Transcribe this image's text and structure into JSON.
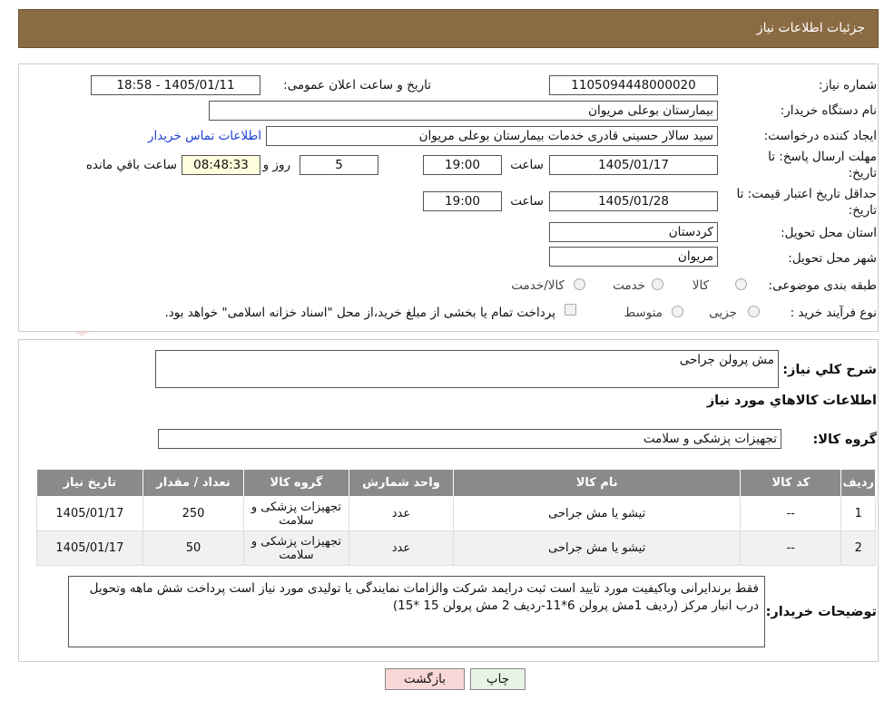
{
  "header": {
    "title": "جزئیات اطلاعات نیاز"
  },
  "form": {
    "need_number_label": "شماره نیاز:",
    "need_number": "1105094448000020",
    "announce_label": "تاریخ و ساعت اعلان عمومی:",
    "announce_value": "1405/01/11 - 18:58",
    "buyer_org_label": "نام دستگاه خریدار:",
    "buyer_org": "بیمارستان بوعلی مریوان",
    "creator_label": "ایجاد کننده درخواست:",
    "creator": "سید سالار حسینی قادری خدمات بیمارستان بوعلی مریوان",
    "contact_link": "اطلاعات تماس خریدار",
    "deadline_label_1": "مهلت ارسال پاسخ: تا",
    "deadline_label_2": "تاریخ:",
    "deadline_date": "1405/01/17",
    "time_label": "ساعت",
    "deadline_time": "19:00",
    "days_value": "5",
    "days_label": "روز و",
    "remaining_time": "08:48:33",
    "remaining_label": "ساعت باقي مانده",
    "validity_label_1": "حداقل تاریخ اعتبار قیمت: تا",
    "validity_label_2": "تاریخ:",
    "validity_date": "1405/01/28",
    "validity_time": "19:00",
    "province_label": "استان محل تحویل:",
    "province": "کردستان",
    "city_label": "شهر محل تحویل:",
    "city": "مریوان",
    "category_label": "طبقه بندی موضوعی:",
    "category_options": [
      "کالا",
      "خدمت",
      "کالا/خدمت"
    ],
    "process_label": "نوع فرآیند خرید :",
    "process_options": [
      "جزیی",
      "متوسط"
    ],
    "payment_note": "پرداخت تمام یا بخشی از مبلغ خرید،از محل \"اسناد خزانه اسلامی\" خواهد بود."
  },
  "summary": {
    "general_desc_label": "شرح کلي نیاز:",
    "general_desc": "مش پرولن جراحی",
    "goods_info_title": "اطلاعات کالاهاي مورد نیاز",
    "goods_group_label": "گروه کالا:",
    "goods_group": "تجهیزات پزشکی و سلامت"
  },
  "table": {
    "headers": [
      "ردیف",
      "کد کالا",
      "نام کالا",
      "واحد شمارش",
      "گروه کالا",
      "تعداد / مقدار",
      "تاریخ نیاز"
    ],
    "rows": [
      [
        "1",
        "--",
        "تیشو یا مش جراحی",
        "عدد",
        "تجهیزات پزشکی و سلامت",
        "250",
        "1405/01/17"
      ],
      [
        "2",
        "--",
        "تیشو یا مش جراحی",
        "عدد",
        "تجهیزات پزشکی و سلامت",
        "50",
        "1405/01/17"
      ]
    ]
  },
  "buyer_notes": {
    "label": "توضیحات خریدار:",
    "text": "فقط برندایرانی وباکیفیت مورد تایید است ثبت درایمد شرکت والزامات نمایندگی یا تولیدی مورد نیاز است پرداخت شش ماهه وتحویل درب انبار مرکز (ردیف 1مش پرولن 6*11-ردیف 2 مش پرولن 15 *15)"
  },
  "buttons": {
    "print": "چاپ",
    "back": "بازگشت"
  },
  "watermark": {
    "text": "AriaTender.neT"
  },
  "colors": {
    "header_bg": "#8B6B43",
    "table_header_bg": "#8a8a8a",
    "link": "#1a3fd6",
    "back_button_bg": "#f8d7d7",
    "print_button_bg": "#e6f5e6"
  }
}
